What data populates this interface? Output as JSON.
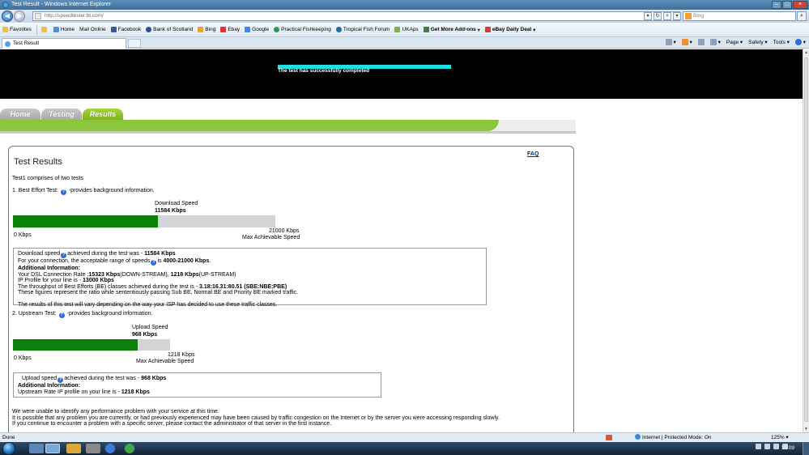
{
  "window": {
    "title": "Test Result - Windows Internet Explorer"
  },
  "address": {
    "url": "http://speedtester.bt.com/"
  },
  "search": {
    "placeholder": "Bing"
  },
  "favorites": {
    "label": "Favorites",
    "items": [
      "Home",
      "Mail Online",
      "Facebook",
      "Bank of Scotland",
      "Bing",
      "Ebay",
      "Google",
      "Practical Fishkeeping",
      "Tropical Fish Forum",
      "UKAps",
      "Get More Add-ons",
      "eBay Daily Deal"
    ]
  },
  "browser_tab": {
    "label": "Test Result"
  },
  "command_bar": {
    "page": "Page",
    "safety": "Safety",
    "tools": "Tools"
  },
  "banner": {
    "status": "The test has successfully completed"
  },
  "site_nav": {
    "tabs": [
      "Home",
      "Testing",
      "Results"
    ],
    "active": "Results"
  },
  "page": {
    "faq": "FAQ",
    "title": "Test Results",
    "intro": "Test1 comprises of two tests",
    "test1": {
      "heading_pre": "1. Best Effort Test:",
      "heading_post": "-provides background information.",
      "bar_label": "Download Speed",
      "bar_value": "11584 Kbps",
      "fill_fraction": 0.552,
      "min_label": "0 Kbps",
      "max_value": "21000 Kbps",
      "max_label": "Max Achievable Speed",
      "info": {
        "line1_pre": "Download speed",
        "line1_post": "achieved during the test was -",
        "line1_value": "11584 Kbps",
        "line2_pre": "For your connection, the acceptable range of speeds",
        "line2_mid": "is",
        "line2_value": "4000-21000 Kbps",
        "line2_end": ".",
        "additional": "Additional Information:",
        "dsl_pre": "Your DSL Connection Rate :",
        "dsl_down": "15323 Kbps",
        "dsl_down_label": "(DOWN-STREAM),",
        "dsl_up": "1218 Kbps",
        "dsl_up_label": "(UP-STREAM)",
        "ip_pre": "IP Profile for your line is -",
        "ip_value": "13000 Kbps",
        "throughput_pre": "The throughput of Best Efforts (BE) classes achieved during the test is -",
        "throughput_value": "3.18:16.31:80.51 (SBE:NBE:PBE)",
        "ratio_text": "These figures represent the ratio while sententiously passing Sub BE, Normal BE and Priority BE marked traffic.",
        "vary_text": "The results of this test will vary depending on the way your ISP has decided to use these traffic classes."
      }
    },
    "test2": {
      "heading_pre": "2. Upstream Test:",
      "heading_post": "-provides background information.",
      "bar_label": "Upload Speed",
      "bar_value": "968 Kbps",
      "fill_fraction": 0.795,
      "min_label": "0 Kbps",
      "max_value": "1218 Kbps",
      "max_label": "Max Achievable Speed",
      "info": {
        "line1_pre": "Upload speed",
        "line1_post": "achieved during the test was -",
        "line1_value": "968 Kbps",
        "additional": "Additional Information:",
        "up_pre": "Upstream Rate IP profile on your line is -",
        "up_value": "1218 Kbps"
      }
    },
    "footer": {
      "line1": "We were unable to identify any performance problem with your service at this time.",
      "line2": "It is possible that any problem you are currently, or had previously experienced may have been caused by traffic congestion on the Internet or by the server you were accessing responding slowly.",
      "line3": "If you continue to encounter a problem with a specific server, please contact the administrator of that server in the first instance."
    }
  },
  "statusbar": {
    "left": "Done",
    "zone": "Internet | Protected Mode: On",
    "zoom": "125%"
  },
  "taskbar": {
    "clock": "15:09"
  }
}
